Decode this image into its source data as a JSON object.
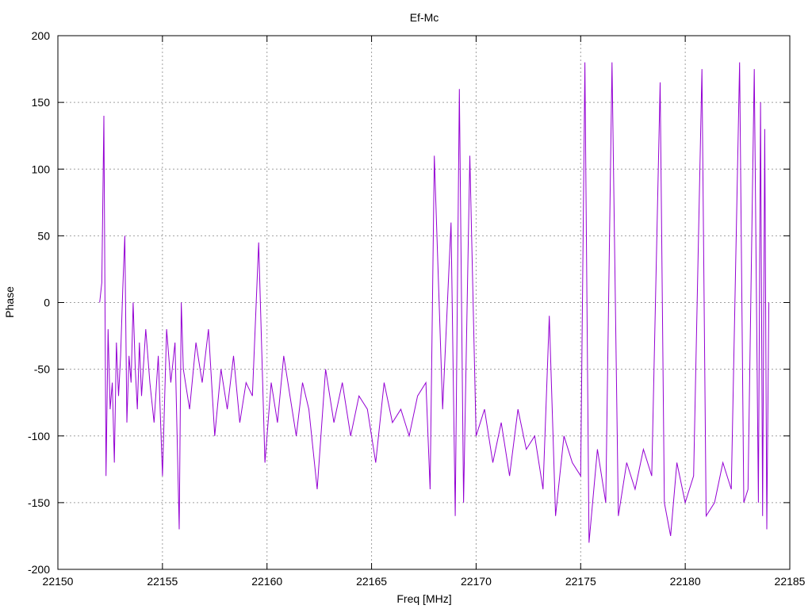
{
  "chart_data": {
    "type": "line",
    "title": "Ef-Mc",
    "xlabel": "Freq [MHz]",
    "ylabel": "Phase",
    "xlim": [
      22150,
      22185
    ],
    "ylim": [
      -200,
      200
    ],
    "xticks": [
      22150,
      22155,
      22160,
      22165,
      22170,
      22175,
      22180,
      22185
    ],
    "yticks": [
      200,
      150,
      100,
      50,
      0,
      -50,
      -100,
      -150,
      -200
    ],
    "grid": true,
    "line_color": "#9400d3",
    "series": [
      {
        "name": "",
        "x": [
          22152.0,
          22152.1,
          22152.2,
          22152.3,
          22152.4,
          22152.5,
          22152.6,
          22152.7,
          22152.8,
          22152.9,
          22153.0,
          22153.1,
          22153.2,
          22153.3,
          22153.4,
          22153.5,
          22153.6,
          22153.7,
          22153.8,
          22153.9,
          22154.0,
          22154.2,
          22154.4,
          22154.6,
          22154.8,
          22155.0,
          22155.2,
          22155.4,
          22155.6,
          22155.8,
          22155.9,
          22156.0,
          22156.3,
          22156.6,
          22156.9,
          22157.2,
          22157.5,
          22157.8,
          22158.1,
          22158.4,
          22158.7,
          22159.0,
          22159.3,
          22159.6,
          22159.9,
          22160.2,
          22160.5,
          22160.8,
          22161.1,
          22161.4,
          22161.7,
          22162.0,
          22162.4,
          22162.8,
          22163.2,
          22163.6,
          22164.0,
          22164.4,
          22164.8,
          22165.2,
          22165.6,
          22166.0,
          22166.4,
          22166.8,
          22167.2,
          22167.6,
          22167.8,
          22168.0,
          22168.4,
          22168.8,
          22169.0,
          22169.2,
          22169.4,
          22169.7,
          22170.0,
          22170.4,
          22170.8,
          22171.2,
          22171.6,
          22172.0,
          22172.4,
          22172.8,
          22173.2,
          22173.5,
          22173.8,
          22174.2,
          22174.6,
          22175.0,
          22175.2,
          22175.4,
          22175.8,
          22176.2,
          22176.5,
          22176.8,
          22177.2,
          22177.6,
          22178.0,
          22178.4,
          22178.8,
          22179.0,
          22179.3,
          22179.6,
          22180.0,
          22180.4,
          22180.8,
          22181.0,
          22181.4,
          22181.8,
          22182.2,
          22182.6,
          22182.8,
          22183.0,
          22183.3,
          22183.5,
          22183.6,
          22183.7,
          22183.8,
          22183.9,
          22184.0
        ],
        "y": [
          0,
          15,
          140,
          -130,
          -20,
          -80,
          -60,
          -120,
          -30,
          -70,
          -40,
          10,
          50,
          -90,
          -40,
          -60,
          0,
          -50,
          -80,
          -30,
          -70,
          -20,
          -60,
          -90,
          -40,
          -130,
          -20,
          -60,
          -30,
          -170,
          0,
          -50,
          -80,
          -30,
          -60,
          -20,
          -100,
          -50,
          -80,
          -40,
          -90,
          -60,
          -70,
          45,
          -120,
          -60,
          -90,
          -40,
          -70,
          -100,
          -60,
          -80,
          -140,
          -50,
          -90,
          -60,
          -100,
          -70,
          -80,
          -120,
          -60,
          -90,
          -80,
          -100,
          -70,
          -60,
          -140,
          110,
          -80,
          60,
          -160,
          160,
          -150,
          110,
          -100,
          -80,
          -120,
          -90,
          -130,
          -80,
          -110,
          -100,
          -140,
          -10,
          -160,
          -100,
          -120,
          -130,
          180,
          -180,
          -110,
          -150,
          180,
          -160,
          -120,
          -140,
          -110,
          -130,
          165,
          -150,
          -175,
          -120,
          -150,
          -130,
          175,
          -160,
          -150,
          -120,
          -140,
          180,
          -150,
          -140,
          175,
          -150,
          150,
          -160,
          130,
          -170,
          0
        ]
      }
    ]
  }
}
